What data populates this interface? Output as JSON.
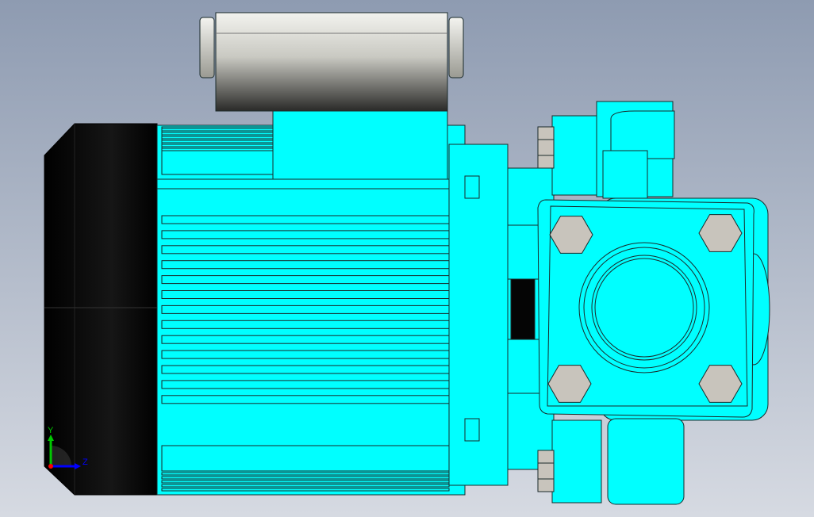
{
  "viewport": {
    "background_top": "#8e9bb1",
    "background_bottom": "#d6dae2"
  },
  "model": {
    "body_color": "#00ffff",
    "edge_color": "#1a2a2a",
    "bolt_color": "#c8c4bc",
    "fan_cover_color": "#0a0a0a",
    "capacitor_color": "#a8a8a0"
  },
  "triad": {
    "y_label": "Y",
    "z_label": "Z",
    "y_color": "#00c800",
    "z_color": "#0000ff",
    "x_color": "#ff0000"
  }
}
